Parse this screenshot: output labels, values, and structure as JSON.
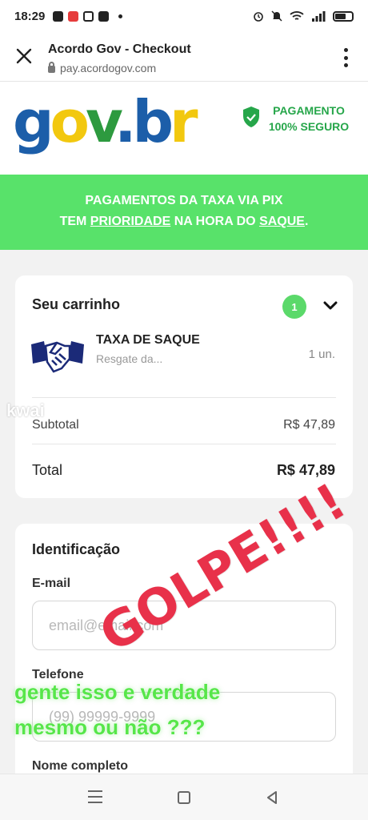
{
  "status_bar": {
    "time": "18:29",
    "left_icons": [
      "chat-icon",
      "app-icon",
      "tiktok-icon",
      "app-icon",
      "dot-icon"
    ],
    "right_icons": [
      "alarm-icon",
      "mute-icon",
      "wifi-icon",
      "signal-icon",
      "battery-icon"
    ],
    "battery_level": 0.6
  },
  "browser": {
    "title": "Acordo Gov - Checkout",
    "url": "pay.acordogov.com"
  },
  "header": {
    "logo_parts": [
      "g",
      "o",
      "v",
      ".",
      "b",
      "r"
    ],
    "logo_colors": [
      "#1c5ea9",
      "#f2c80f",
      "#2d9a3f",
      "#1c5ea9",
      "#1c5ea9",
      "#f2c80f"
    ],
    "secure_line1": "PAGAMENTO",
    "secure_line2": "100% SEGURO",
    "secure_color": "#26a64a"
  },
  "banner": {
    "line1": "PAGAMENTOS DA TAXA VIA PIX",
    "line2_pre": "TEM ",
    "line2_link1": "PRIORIDADE",
    "line2_mid": " NA HORA DO ",
    "line2_link2": "SAQUE",
    "line2_post": ".",
    "background": "#58e26a"
  },
  "cart": {
    "title": "Seu carrinho",
    "count": "1",
    "item": {
      "name": "TAXA DE SAQUE",
      "description": "Resgate da...",
      "quantity": "1 un."
    },
    "subtotal_label": "Subtotal",
    "subtotal_value": "R$ 47,89",
    "total_label": "Total",
    "total_value": "R$ 47,89"
  },
  "form": {
    "title": "Identificação",
    "email_label": "E-mail",
    "email_placeholder": "email@email.com",
    "phone_label": "Telefone",
    "phone_placeholder": "(99) 99999-9999",
    "name_label": "Nome completo"
  },
  "overlay": {
    "stamp": "GOLPE!!!!",
    "comment": "gente isso e verdade mesmo ou não ???",
    "watermark": "kwai"
  }
}
